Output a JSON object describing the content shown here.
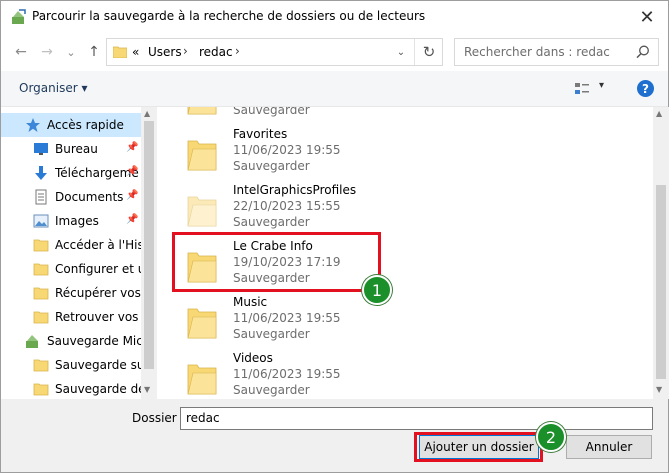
{
  "window": {
    "title": "Parcourir la sauvegarde à la recherche de dossiers ou de lecteurs",
    "close_glyph": "✕"
  },
  "nav": {
    "back_glyph": "←",
    "forward_glyph": "→",
    "recent_glyph": "⌄",
    "up_glyph": "↑"
  },
  "address": {
    "prefix": "«",
    "segments": [
      "Users",
      "redac"
    ],
    "separator": "›",
    "dropdown_glyph": "⌄",
    "refresh_glyph": "↻"
  },
  "search": {
    "placeholder": "Rechercher dans : redac"
  },
  "toolbar": {
    "organise_label": "Organiser ▾",
    "view_chevron": "▾",
    "help_label": "?"
  },
  "sidebar": {
    "items": [
      {
        "label": "Accès rapide",
        "icon": "star-icon",
        "pinned": false,
        "selected": true
      },
      {
        "label": "Bureau",
        "icon": "desktop-icon",
        "pinned": true
      },
      {
        "label": "Téléchargeme",
        "icon": "download-icon",
        "pinned": true
      },
      {
        "label": "Documents",
        "icon": "documents-icon",
        "pinned": true
      },
      {
        "label": "Images",
        "icon": "images-icon",
        "pinned": true
      },
      {
        "label": "Accéder à l'Histo",
        "icon": "folder-icon"
      },
      {
        "label": "Configurer et uti",
        "icon": "folder-icon"
      },
      {
        "label": "Récupérer vos fic",
        "icon": "folder-icon"
      },
      {
        "label": "Retrouver vos do",
        "icon": "folder-icon"
      },
      {
        "label": "Sauvegarde Micro",
        "icon": "backup-icon"
      },
      {
        "label": "Sauvegarde sur l",
        "icon": "folder-icon"
      },
      {
        "label": "Sauvegarde de r",
        "icon": "folder-icon"
      }
    ],
    "pin_glyph": "📌"
  },
  "files": [
    {
      "name": "",
      "date": "",
      "type": "Sauvegarder",
      "partial": true
    },
    {
      "name": "Favorites",
      "date": "11/06/2023 19:55",
      "type": "Sauvegarder"
    },
    {
      "name": "IntelGraphicsProfiles",
      "date": "22/10/2023 15:55",
      "type": "Sauvegarder",
      "faded": true
    },
    {
      "name": "Le Crabe Info",
      "date": "19/10/2023 17:19",
      "type": "Sauvegarder"
    },
    {
      "name": "Music",
      "date": "11/06/2023 19:55",
      "type": "Sauvegarder"
    },
    {
      "name": "Videos",
      "date": "11/06/2023 19:55",
      "type": "Sauvegarder"
    }
  ],
  "folder_field": {
    "label": "Dossier :",
    "value": "redac"
  },
  "buttons": {
    "add": "Ajouter un dossier",
    "cancel": "Annuler"
  },
  "annotations": {
    "step1": "1",
    "step2": "2"
  },
  "colors": {
    "highlight": "#e3101f",
    "badge": "#1a8f2a",
    "accent": "#0078d7",
    "folder": "#f8d775"
  }
}
